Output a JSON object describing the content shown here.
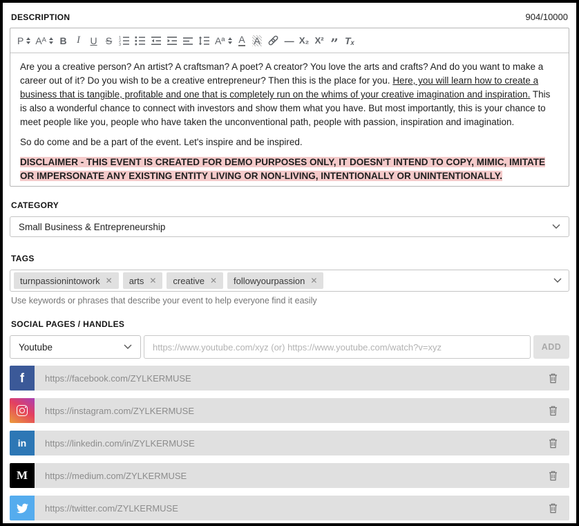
{
  "header": {
    "label": "DESCRIPTION",
    "char_count": "904/10000"
  },
  "icons": {
    "close": "✕"
  },
  "editor": {
    "toolbar": {
      "paragraph": "P",
      "font_size": "Aᴬ",
      "bold": "B",
      "italic": "I",
      "underline": "U",
      "strikethrough": "S",
      "font_case": "Aª",
      "font_color": "A",
      "highlight_color": "A",
      "horizontal_rule": "—",
      "subscript": "X₂",
      "superscript": "X²",
      "blockquote": "”",
      "clear_format": "Tₓ"
    },
    "content": {
      "p1_normal": "Are you a creative person? An artist? A craftsman? A poet? A creator? You love the arts and crafts? And do you want to make a career out of it? Do you wish to be a creative entrepreneur? Then this is the place for you. ",
      "p1_underlined": "Here, you will learn how to create a business that is tangible, profitable and one that is completely run on the whims of your creative imagination and inspiration.",
      "p1_after": " This is also a wonderful chance to connect with investors and show them what you have. But most importantly, this is your chance to meet people like you, people who have taken the unconventional path, people with passion, inspiration and imagination.",
      "p2": "So do come and be a part of the event. Let's inspire and be inspired.",
      "disclaimer": "DISCLAIMER - THIS EVENT IS CREATED FOR DEMO PURPOSES ONLY, IT DOESN'T INTEND TO COPY, MIMIC, IMITATE OR IMPERSONATE ANY EXISTING ENTITY LIVING OR NON-LIVING, INTENTIONALLY OR UNINTENTIONALLY.",
      "disclaimer_highlight_color": "#f4caca"
    }
  },
  "category": {
    "label": "CATEGORY",
    "value": "Small Business & Entrepreneurship"
  },
  "tags": {
    "label": "TAGS",
    "items": [
      {
        "text": "turnpassionintowork"
      },
      {
        "text": "arts"
      },
      {
        "text": "creative"
      },
      {
        "text": "followyourpassion"
      }
    ],
    "helper": "Use keywords or phrases that describe your event to help everyone find it easily"
  },
  "social": {
    "label": "SOCIAL PAGES / HANDLES",
    "platform_select_value": "Youtube",
    "url_placeholder": "https://www.youtube.com/xyz (or) https://www.youtube.com/watch?v=xyz",
    "add_label": "ADD",
    "rows": [
      {
        "platform": "facebook",
        "icon_glyph": "f",
        "url": "https://facebook.com/ZYLKERMUSE",
        "color": "#3b5998"
      },
      {
        "platform": "instagram",
        "icon_glyph": "",
        "url": "https://instagram.com/ZYLKERMUSE",
        "color": "gradient(#eb9c3b,#e4405f,#a940b5)"
      },
      {
        "platform": "linkedin",
        "icon_glyph": "in",
        "url": "https://linkedin.com/in/ZYLKERMUSE",
        "color": "#2d77b5"
      },
      {
        "platform": "medium",
        "icon_glyph": "M",
        "url": "https://medium.com/ZYLKERMUSE",
        "color": "#000000"
      },
      {
        "platform": "twitter",
        "icon_glyph": "",
        "url": "https://twitter.com/ZYLKERMUSE",
        "color": "#55acee"
      }
    ]
  }
}
